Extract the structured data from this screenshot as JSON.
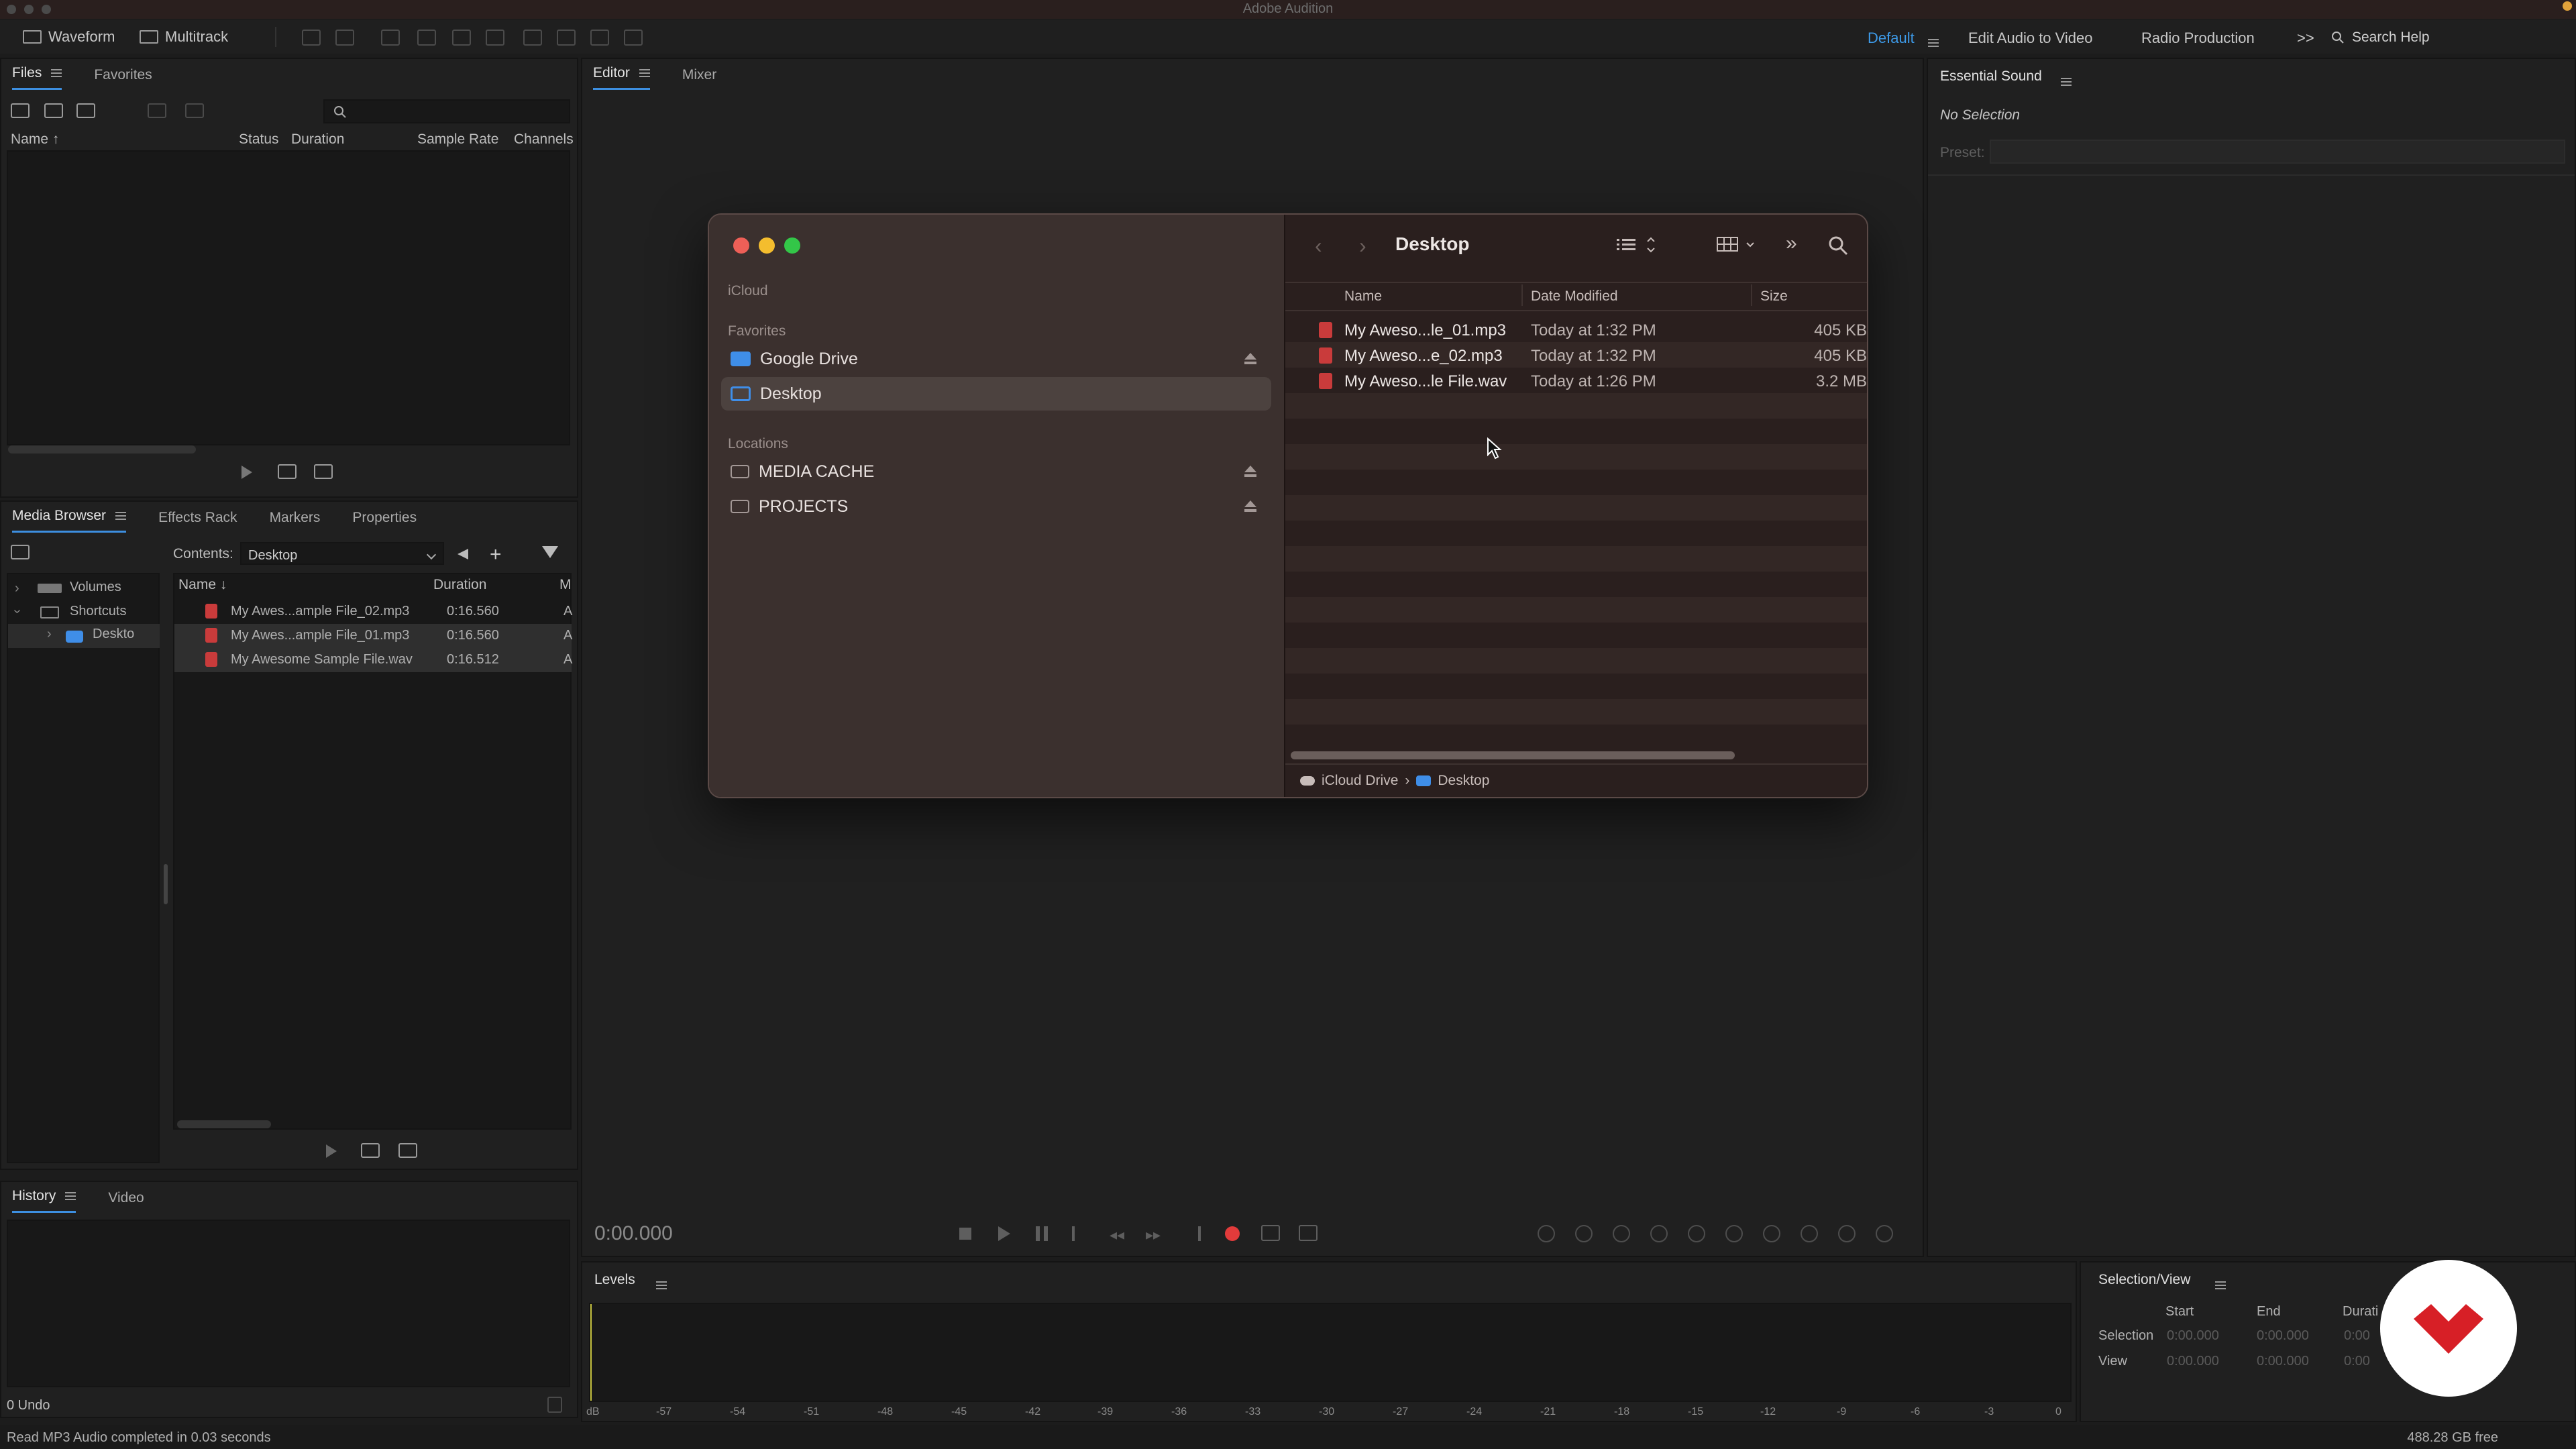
{
  "window": {
    "title": "Adobe Audition"
  },
  "toolbar": {
    "waveform_label": "Waveform",
    "multitrack_label": "Multitrack",
    "workspaces": [
      {
        "label": "Default",
        "active": true
      },
      {
        "label": "Edit Audio to Video",
        "active": false
      },
      {
        "label": "Radio Production",
        "active": false
      }
    ],
    "overflow_label": ">>",
    "search_placeholder": "Search Help"
  },
  "files_panel": {
    "tabs": [
      "Files",
      "Favorites"
    ],
    "columns": [
      "Name ↑",
      "Status",
      "Duration",
      "Sample Rate",
      "Channels"
    ]
  },
  "media_browser": {
    "tabs": [
      "Media Browser",
      "Effects Rack",
      "Markers",
      "Properties"
    ],
    "contents_label": "Contents:",
    "contents_value": "Desktop",
    "tree": [
      "Volumes",
      "Shortcuts",
      "Deskto"
    ],
    "columns": [
      "Name ↓",
      "Duration",
      "M"
    ],
    "rows": [
      {
        "name": "My Awes...ample File_02.mp3",
        "duration": "0:16.560",
        "m": "A"
      },
      {
        "name": "My Awes...ample File_01.mp3",
        "duration": "0:16.560",
        "m": "A"
      },
      {
        "name": "My Awesome Sample File.wav",
        "duration": "0:16.512",
        "m": "A"
      }
    ]
  },
  "history_panel": {
    "tabs": [
      "History",
      "Video"
    ],
    "undo_label": "0 Undo"
  },
  "editor": {
    "tabs": [
      "Editor",
      "Mixer"
    ],
    "time": "0:00.000"
  },
  "essential_sound": {
    "title": "Essential Sound",
    "no_selection": "No Selection",
    "preset_label": "Preset:"
  },
  "levels": {
    "title": "Levels",
    "ruler": [
      "dB",
      "-57",
      "-54",
      "-51",
      "-48",
      "-45",
      "-42",
      "-39",
      "-36",
      "-33",
      "-30",
      "-27",
      "-24",
      "-21",
      "-18",
      "-15",
      "-12",
      "-9",
      "-6",
      "-3",
      "0"
    ]
  },
  "selection_view": {
    "title": "Selection/View",
    "columns": [
      "Start",
      "End",
      "Durati"
    ],
    "rows": [
      {
        "label": "Selection",
        "start": "0:00.000",
        "end": "0:00.000",
        "dur": "0:00"
      },
      {
        "label": "View",
        "start": "0:00.000",
        "end": "0:00.000",
        "dur": "0:00"
      }
    ]
  },
  "status_bar": {
    "message": "Read MP3 Audio completed in 0.03 seconds",
    "disk_free": "488.28 GB free"
  },
  "finder": {
    "title": "Desktop",
    "sidebar": {
      "icloud_label": "iCloud",
      "favorites_label": "Favorites",
      "favorites": [
        {
          "label": "Google Drive",
          "selected": false
        },
        {
          "label": "Desktop",
          "selected": true
        }
      ],
      "locations_label": "Locations",
      "locations": [
        {
          "label": "MEDIA CACHE"
        },
        {
          "label": "PROJECTS"
        }
      ]
    },
    "columns": [
      "Name",
      "Date Modified",
      "Size"
    ],
    "files": [
      {
        "name": "My Aweso...le_01.mp3",
        "date": "Today at 1:32 PM",
        "size": "405 KB"
      },
      {
        "name": "My Aweso...e_02.mp3",
        "date": "Today at 1:32 PM",
        "size": "405 KB"
      },
      {
        "name": "My Aweso...le File.wav",
        "date": "Today at 1:26 PM",
        "size": "3.2 MB"
      }
    ],
    "path": [
      "iCloud Drive",
      "›",
      "Desktop"
    ]
  },
  "colors": {
    "accent": "#3d8fe0",
    "record": "#e23b3b",
    "badge": "#d71f26",
    "finder_bg": "#2a1f1e"
  }
}
